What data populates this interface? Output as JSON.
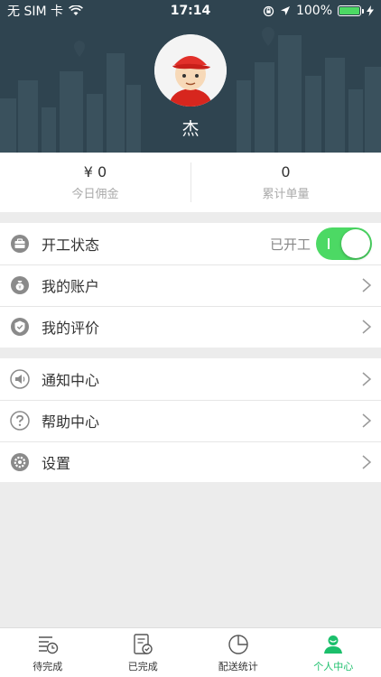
{
  "status_bar": {
    "carrier": "无 SIM 卡",
    "time": "17:14",
    "battery": "100%"
  },
  "profile": {
    "name": "杰"
  },
  "stats": [
    {
      "value": "¥ 0",
      "label": "今日佣金"
    },
    {
      "value": "0",
      "label": "累计单量"
    }
  ],
  "menu": {
    "group1": [
      {
        "label": "开工状态",
        "state": "已开工",
        "toggle_on": true
      },
      {
        "label": "我的账户"
      },
      {
        "label": "我的评价"
      }
    ],
    "group2": [
      {
        "label": "通知中心"
      },
      {
        "label": "帮助中心"
      },
      {
        "label": "设置"
      }
    ]
  },
  "tabbar": {
    "active_color": "#1bbf6b",
    "items": [
      {
        "label": "待完成",
        "icon": "pending-list-icon"
      },
      {
        "label": "已完成",
        "icon": "completed-doc-icon"
      },
      {
        "label": "配送统计",
        "icon": "pie-chart-icon"
      },
      {
        "label": "个人中心",
        "icon": "person-icon",
        "active": true
      }
    ]
  }
}
